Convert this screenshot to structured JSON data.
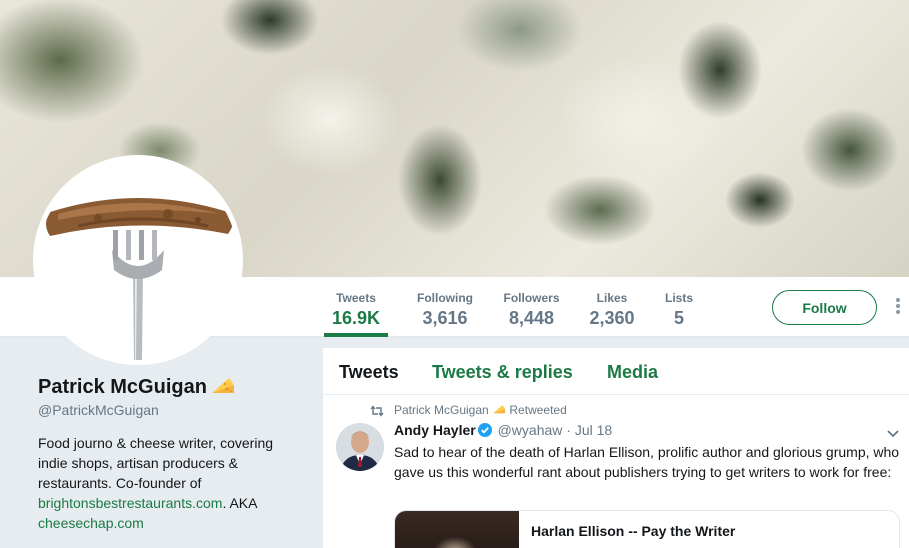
{
  "profile": {
    "name": "Patrick McGuigan",
    "name_emoji": "cheese-wedge-icon",
    "handle": "@PatrickMcGuigan",
    "bio_text": "Food journo & cheese writer, covering indie shops, artisan producers & restaurants. Co-founder of",
    "bio_link1": "brightonsbestrestaurants.com",
    "bio_mid": ". AKA",
    "bio_link2": "cheesechap.com"
  },
  "nav": {
    "stats": [
      {
        "label": "Tweets",
        "value": "16.9K"
      },
      {
        "label": "Following",
        "value": "3,616"
      },
      {
        "label": "Followers",
        "value": "8,448"
      },
      {
        "label": "Likes",
        "value": "2,360"
      },
      {
        "label": "Lists",
        "value": "5"
      }
    ],
    "active_stat": "Tweets",
    "follow_label": "Follow"
  },
  "timeline": {
    "tabs": [
      "Tweets",
      "Tweets & replies",
      "Media"
    ],
    "active_tab": "Tweets",
    "tweet": {
      "retweeted_by": "Patrick McGuigan",
      "retweeted_suffix": "Retweeted",
      "author_name": "Andy Hayler",
      "author_handle": "@wyahaw",
      "separator": "·",
      "date": "Jul 18",
      "text": "Sad to hear of the death of Harlan Ellison, prolific author and glorious grump, who gave us this wonderful rant about publishers trying to get writers to work for free:",
      "card_title": "Harlan Ellison -- Pay the Writer"
    }
  },
  "colors": {
    "accent": "#1b7a45",
    "secondary_text": "#657786",
    "background": "#e6ecf0",
    "verified": "#1da1f2"
  }
}
